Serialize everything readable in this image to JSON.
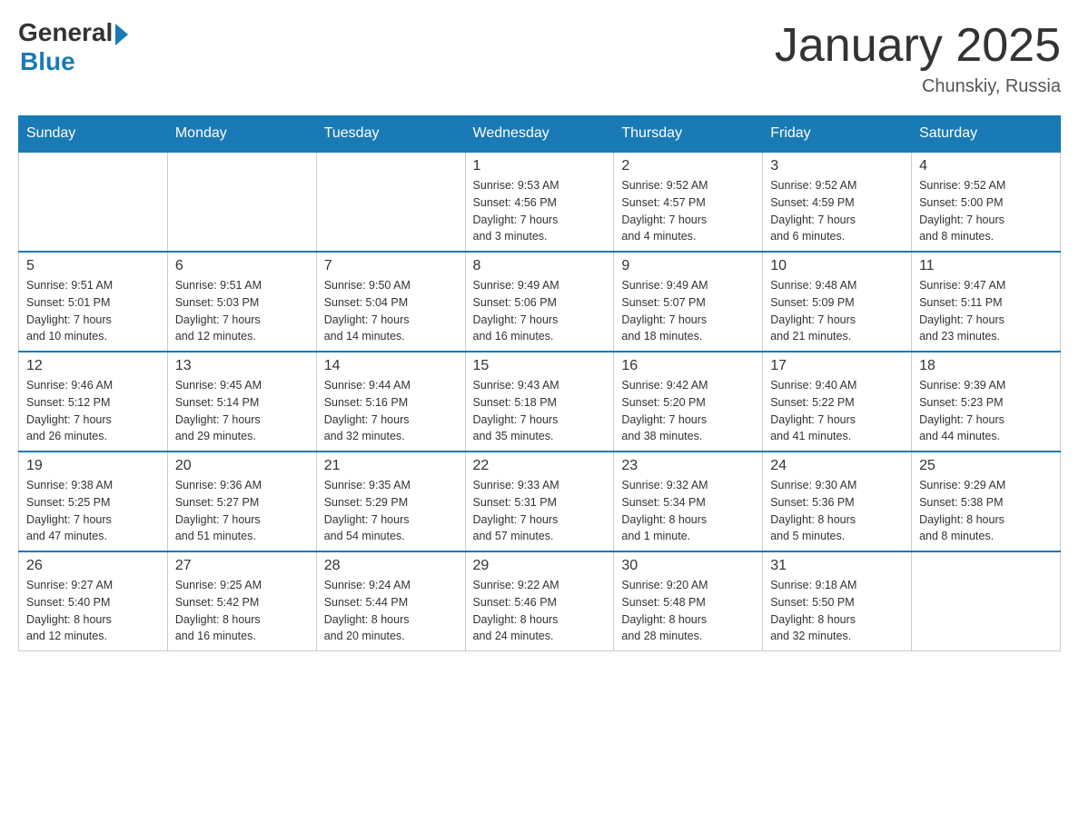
{
  "header": {
    "logo": {
      "general": "General",
      "blue": "Blue",
      "subtitle": "Blue"
    },
    "title": "January 2025",
    "location": "Chunskiy, Russia"
  },
  "columns": [
    "Sunday",
    "Monday",
    "Tuesday",
    "Wednesday",
    "Thursday",
    "Friday",
    "Saturday"
  ],
  "weeks": [
    [
      {
        "day": "",
        "info": ""
      },
      {
        "day": "",
        "info": ""
      },
      {
        "day": "",
        "info": ""
      },
      {
        "day": "1",
        "info": "Sunrise: 9:53 AM\nSunset: 4:56 PM\nDaylight: 7 hours\nand 3 minutes."
      },
      {
        "day": "2",
        "info": "Sunrise: 9:52 AM\nSunset: 4:57 PM\nDaylight: 7 hours\nand 4 minutes."
      },
      {
        "day": "3",
        "info": "Sunrise: 9:52 AM\nSunset: 4:59 PM\nDaylight: 7 hours\nand 6 minutes."
      },
      {
        "day": "4",
        "info": "Sunrise: 9:52 AM\nSunset: 5:00 PM\nDaylight: 7 hours\nand 8 minutes."
      }
    ],
    [
      {
        "day": "5",
        "info": "Sunrise: 9:51 AM\nSunset: 5:01 PM\nDaylight: 7 hours\nand 10 minutes."
      },
      {
        "day": "6",
        "info": "Sunrise: 9:51 AM\nSunset: 5:03 PM\nDaylight: 7 hours\nand 12 minutes."
      },
      {
        "day": "7",
        "info": "Sunrise: 9:50 AM\nSunset: 5:04 PM\nDaylight: 7 hours\nand 14 minutes."
      },
      {
        "day": "8",
        "info": "Sunrise: 9:49 AM\nSunset: 5:06 PM\nDaylight: 7 hours\nand 16 minutes."
      },
      {
        "day": "9",
        "info": "Sunrise: 9:49 AM\nSunset: 5:07 PM\nDaylight: 7 hours\nand 18 minutes."
      },
      {
        "day": "10",
        "info": "Sunrise: 9:48 AM\nSunset: 5:09 PM\nDaylight: 7 hours\nand 21 minutes."
      },
      {
        "day": "11",
        "info": "Sunrise: 9:47 AM\nSunset: 5:11 PM\nDaylight: 7 hours\nand 23 minutes."
      }
    ],
    [
      {
        "day": "12",
        "info": "Sunrise: 9:46 AM\nSunset: 5:12 PM\nDaylight: 7 hours\nand 26 minutes."
      },
      {
        "day": "13",
        "info": "Sunrise: 9:45 AM\nSunset: 5:14 PM\nDaylight: 7 hours\nand 29 minutes."
      },
      {
        "day": "14",
        "info": "Sunrise: 9:44 AM\nSunset: 5:16 PM\nDaylight: 7 hours\nand 32 minutes."
      },
      {
        "day": "15",
        "info": "Sunrise: 9:43 AM\nSunset: 5:18 PM\nDaylight: 7 hours\nand 35 minutes."
      },
      {
        "day": "16",
        "info": "Sunrise: 9:42 AM\nSunset: 5:20 PM\nDaylight: 7 hours\nand 38 minutes."
      },
      {
        "day": "17",
        "info": "Sunrise: 9:40 AM\nSunset: 5:22 PM\nDaylight: 7 hours\nand 41 minutes."
      },
      {
        "day": "18",
        "info": "Sunrise: 9:39 AM\nSunset: 5:23 PM\nDaylight: 7 hours\nand 44 minutes."
      }
    ],
    [
      {
        "day": "19",
        "info": "Sunrise: 9:38 AM\nSunset: 5:25 PM\nDaylight: 7 hours\nand 47 minutes."
      },
      {
        "day": "20",
        "info": "Sunrise: 9:36 AM\nSunset: 5:27 PM\nDaylight: 7 hours\nand 51 minutes."
      },
      {
        "day": "21",
        "info": "Sunrise: 9:35 AM\nSunset: 5:29 PM\nDaylight: 7 hours\nand 54 minutes."
      },
      {
        "day": "22",
        "info": "Sunrise: 9:33 AM\nSunset: 5:31 PM\nDaylight: 7 hours\nand 57 minutes."
      },
      {
        "day": "23",
        "info": "Sunrise: 9:32 AM\nSunset: 5:34 PM\nDaylight: 8 hours\nand 1 minute."
      },
      {
        "day": "24",
        "info": "Sunrise: 9:30 AM\nSunset: 5:36 PM\nDaylight: 8 hours\nand 5 minutes."
      },
      {
        "day": "25",
        "info": "Sunrise: 9:29 AM\nSunset: 5:38 PM\nDaylight: 8 hours\nand 8 minutes."
      }
    ],
    [
      {
        "day": "26",
        "info": "Sunrise: 9:27 AM\nSunset: 5:40 PM\nDaylight: 8 hours\nand 12 minutes."
      },
      {
        "day": "27",
        "info": "Sunrise: 9:25 AM\nSunset: 5:42 PM\nDaylight: 8 hours\nand 16 minutes."
      },
      {
        "day": "28",
        "info": "Sunrise: 9:24 AM\nSunset: 5:44 PM\nDaylight: 8 hours\nand 20 minutes."
      },
      {
        "day": "29",
        "info": "Sunrise: 9:22 AM\nSunset: 5:46 PM\nDaylight: 8 hours\nand 24 minutes."
      },
      {
        "day": "30",
        "info": "Sunrise: 9:20 AM\nSunset: 5:48 PM\nDaylight: 8 hours\nand 28 minutes."
      },
      {
        "day": "31",
        "info": "Sunrise: 9:18 AM\nSunset: 5:50 PM\nDaylight: 8 hours\nand 32 minutes."
      },
      {
        "day": "",
        "info": ""
      }
    ]
  ]
}
